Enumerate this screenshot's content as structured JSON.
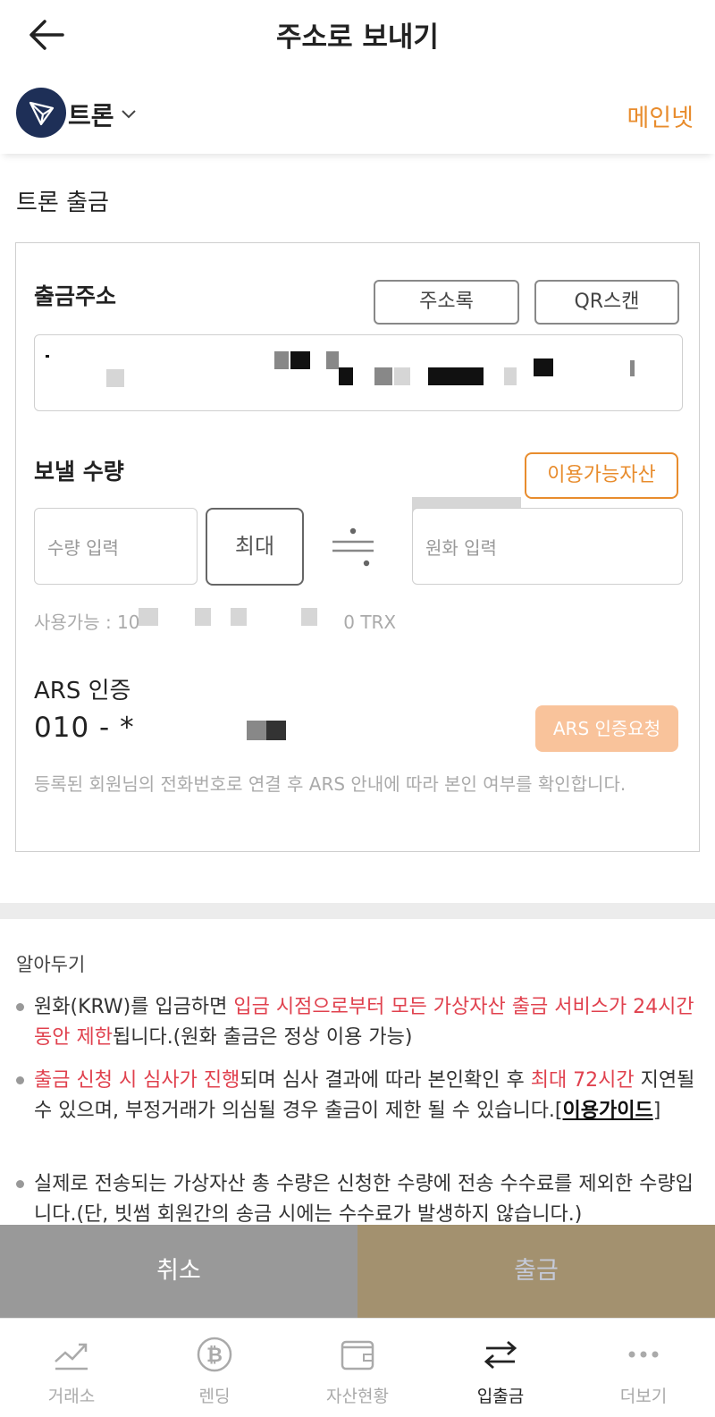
{
  "header": {
    "title": "주소로 보내기",
    "back_icon": "arrow-left-icon"
  },
  "coin": {
    "name": "트론",
    "network": "메인넷",
    "logo_icon": "tron-logo-icon"
  },
  "form": {
    "section_title": "트론 출금",
    "address_label": "출금주소",
    "address_book_button": "주소록",
    "qr_scan_button": "QR스캔",
    "amount_label": "보낼 수량",
    "available_assets_button": "이용가능자산",
    "amount_placeholder": "수량 입력",
    "max_button": "최대",
    "krw_placeholder": "원화 입력",
    "available_prefix": "사용가능 : 10",
    "available_suffix": "0 TRX",
    "ars_label": "ARS 인증",
    "phone_prefix": "010 - *",
    "ars_button": "ARS 인증요청",
    "ars_description": "등록된 회원님의 전화번호로 연결 후 ARS 안내에 따라 본인 여부를 확인합니다."
  },
  "notice": {
    "title": "알아두기",
    "items": [
      {
        "p1": "원화(KRW)를 입금하면 ",
        "red": "입금 시점으로부터 모든 가상자산 출금 서비스가 24시간 동안 제한",
        "p2": "됩니다.(원화 출금은 정상 이용 가능)"
      },
      {
        "red1": "출금 신청 시 심사가 진행",
        "p1": "되며 심사 결과에 따라 본인확인 후 ",
        "red2": "최대 72시간",
        "p2": " 지연될 수 있으며, 부정거래가 의심될 경우 출금이 제한 될 수 있습니다.[",
        "link": "이용가이드",
        "p3": "]"
      },
      {
        "text": "실제로 전송되는 가상자산 총 수량은 신청한 수량에 전송 수수료를 제외한 수량입니다.(단, 빗썸 회원간의 송금 시에는 수수료가 발생하지 않습니다.)"
      }
    ]
  },
  "actions": {
    "cancel": "취소",
    "submit": "출금"
  },
  "tabs": [
    {
      "label": "거래소",
      "icon": "chart-trend-icon"
    },
    {
      "label": "렌딩",
      "icon": "bitcoin-coin-icon"
    },
    {
      "label": "자산현황",
      "icon": "wallet-icon"
    },
    {
      "label": "입출금",
      "icon": "transfer-arrows-icon",
      "active": true
    },
    {
      "label": "더보기",
      "icon": "more-dots-icon"
    }
  ],
  "colors": {
    "accent_orange": "#e88c2d",
    "alert_red": "#e0414e",
    "submit_bg": "#a3916f",
    "cancel_bg": "#999999",
    "ars_button_bg": "#f9c39b"
  }
}
